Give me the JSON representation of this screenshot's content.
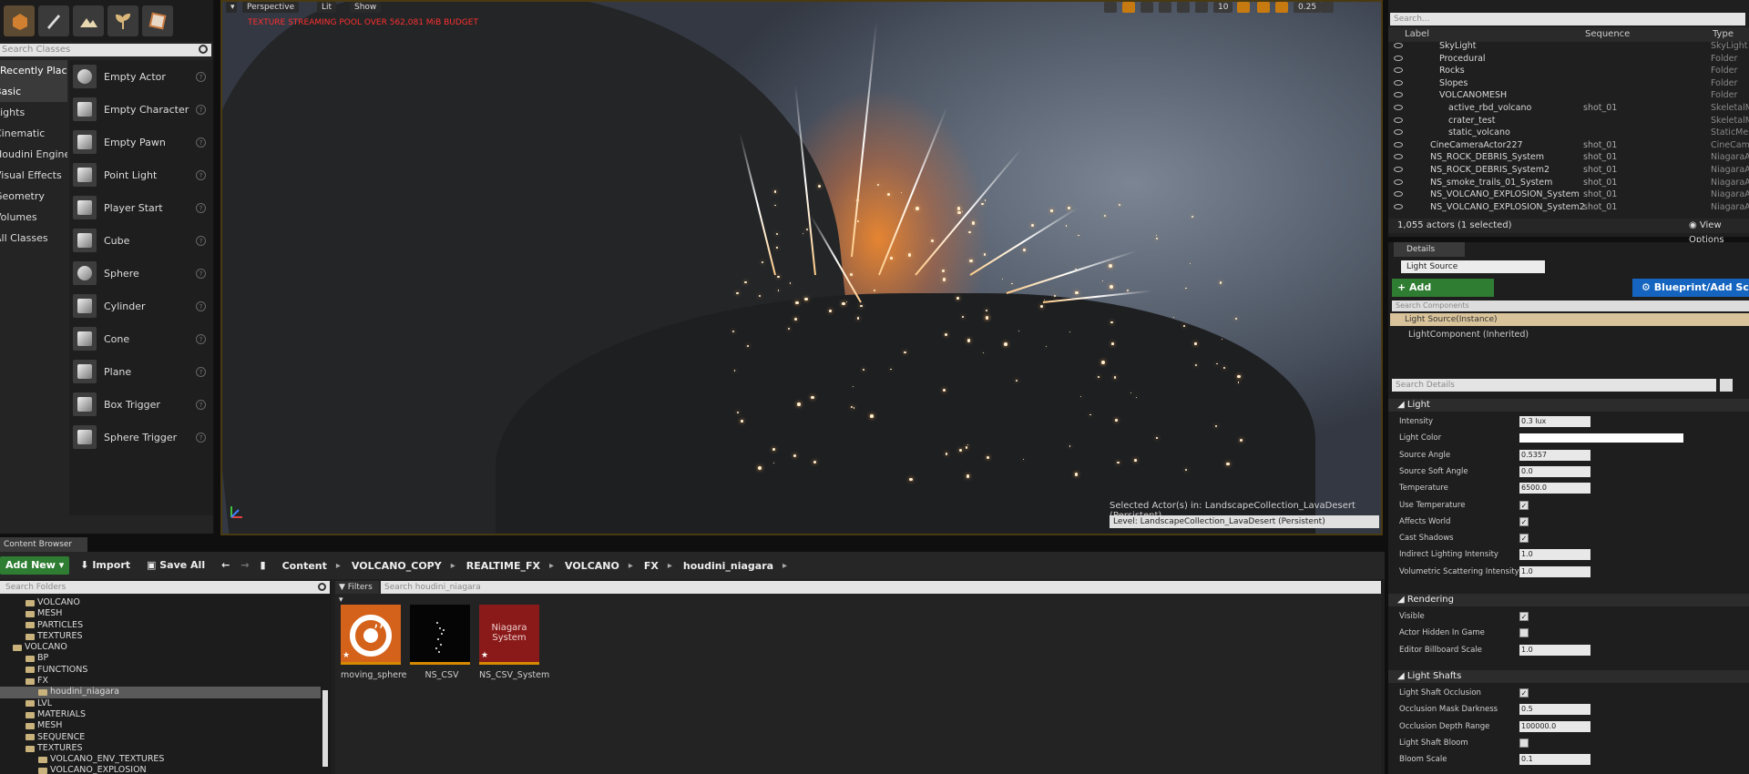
{
  "place_actors": {
    "search_placeholder": "Search Classes",
    "categories": [
      "Recently Placed",
      "Basic",
      "Lights",
      "Cinematic",
      "Houdini Engine",
      "Visual Effects",
      "Geometry",
      "Volumes",
      "All Classes"
    ],
    "actors": [
      "Empty Actor",
      "Empty Character",
      "Empty Pawn",
      "Point Light",
      "Player Start",
      "Cube",
      "Sphere",
      "Cylinder",
      "Cone",
      "Plane",
      "Box Trigger",
      "Sphere Trigger"
    ]
  },
  "viewport": {
    "perspective": "Perspective",
    "lit": "Lit",
    "show": "Show",
    "streaming_warning": "TEXTURE STREAMING POOL OVER 562,081 MiB BUDGET",
    "selected_actor": "Selected Actor(s) in:  LandscapeCollection_LavaDesert (Persistent)",
    "level": "Level:  LandscapeCollection_LavaDesert (Persistent)",
    "toolbar_values": [
      "10",
      "0.25"
    ]
  },
  "content_browser": {
    "tab": "Content Browser",
    "add_new": "Add New",
    "import": "Import",
    "save_all": "Save All",
    "breadcrumb": [
      "Content",
      "VOLCANO_COPY",
      "REALTIME_FX",
      "VOLCANO",
      "FX",
      "houdini_niagara"
    ],
    "search_folders": "Search Folders",
    "filters": "Filters",
    "search_assets": "Search houdini_niagara",
    "folders": [
      {
        "name": "VOLCANO",
        "indent": 1
      },
      {
        "name": "MESH",
        "indent": 1
      },
      {
        "name": "PARTICLES",
        "indent": 1
      },
      {
        "name": "TEXTURES",
        "indent": 1
      },
      {
        "name": "VOLCANO",
        "indent": 0
      },
      {
        "name": "BP",
        "indent": 1
      },
      {
        "name": "FUNCTIONS",
        "indent": 1
      },
      {
        "name": "FX",
        "indent": 1
      },
      {
        "name": "houdini_niagara",
        "indent": 2,
        "selected": true
      },
      {
        "name": "LVL",
        "indent": 1
      },
      {
        "name": "MATERIALS",
        "indent": 1
      },
      {
        "name": "MESH",
        "indent": 1
      },
      {
        "name": "SEQUENCE",
        "indent": 1
      },
      {
        "name": "TEXTURES",
        "indent": 1
      },
      {
        "name": "VOLCANO_ENV_TEXTURES",
        "indent": 2
      },
      {
        "name": "VOLCANO_EXPLOSION",
        "indent": 2
      }
    ],
    "assets": [
      {
        "name": "moving_sphere",
        "thumb_text": ""
      },
      {
        "name": "NS_CSV",
        "thumb_text": ""
      },
      {
        "name": "NS_CSV_System",
        "thumb_text": "Niagara System"
      }
    ]
  },
  "outliner": {
    "search_placeholder": "Search...",
    "columns": [
      "Label",
      "Sequence",
      "Type"
    ],
    "rows": [
      {
        "label": "SkyLight",
        "seq": "",
        "type": "SkyLight",
        "indent": 1
      },
      {
        "label": "Procedural",
        "seq": "",
        "type": "Folder",
        "indent": 1
      },
      {
        "label": "Rocks",
        "seq": "",
        "type": "Folder",
        "indent": 1
      },
      {
        "label": "Slopes",
        "seq": "",
        "type": "Folder",
        "indent": 1
      },
      {
        "label": "VOLCANOMESH",
        "seq": "",
        "type": "Folder",
        "indent": 1
      },
      {
        "label": "active_rbd_volcano",
        "seq": "shot_01",
        "type": "SkeletalMe",
        "indent": 2
      },
      {
        "label": "crater_test",
        "seq": "",
        "type": "SkeletalMe",
        "indent": 2
      },
      {
        "label": "static_volcano",
        "seq": "",
        "type": "StaticMesh",
        "indent": 2
      },
      {
        "label": "CineCameraActor227",
        "seq": "shot_01",
        "type": "CineCamer",
        "indent": 0
      },
      {
        "label": "NS_ROCK_DEBRIS_System",
        "seq": "shot_01",
        "type": "NiagaraAc",
        "indent": 0
      },
      {
        "label": "NS_ROCK_DEBRIS_System2",
        "seq": "shot_01",
        "type": "NiagaraAc",
        "indent": 0
      },
      {
        "label": "NS_smoke_trails_01_System",
        "seq": "shot_01",
        "type": "NiagaraAc",
        "indent": 0
      },
      {
        "label": "NS_VOLCANO_EXPLOSION_System",
        "seq": "shot_01",
        "type": "NiagaraAc",
        "indent": 0
      },
      {
        "label": "NS_VOLCANO_EXPLOSION_System2",
        "seq": "shot_01",
        "type": "NiagaraAc",
        "indent": 0
      }
    ],
    "count": "1,055 actors (1 selected)",
    "view_options": "View Options"
  },
  "details": {
    "tab": "Details",
    "name": "Light Source",
    "add_component": "+ Add Component -",
    "blueprint": "Blueprint/Add Script",
    "search_components": "Search Components",
    "instance": "Light Source(Instance)",
    "inherited": "LightComponent (Inherited)",
    "search_details": "Search Details",
    "sections": {
      "light": "Light",
      "rendering": "Rendering",
      "shafts": "Light Shafts"
    },
    "light_props": [
      {
        "name": "Intensity",
        "value": "0.3 lux",
        "kind": "num"
      },
      {
        "name": "Light Color",
        "value": "",
        "kind": "color"
      },
      {
        "name": "Source Angle",
        "value": "0.5357",
        "kind": "num"
      },
      {
        "name": "Source Soft Angle",
        "value": "0.0",
        "kind": "num"
      },
      {
        "name": "Temperature",
        "value": "6500.0",
        "kind": "num"
      },
      {
        "name": "Use Temperature",
        "value": "✓",
        "kind": "check"
      },
      {
        "name": "Affects World",
        "value": "✓",
        "kind": "check"
      },
      {
        "name": "Cast Shadows",
        "value": "✓",
        "kind": "check"
      },
      {
        "name": "Indirect Lighting Intensity",
        "value": "1.0",
        "kind": "num"
      },
      {
        "name": "Volumetric Scattering Intensity",
        "value": "1.0",
        "kind": "num"
      }
    ],
    "render_props": [
      {
        "name": "Visible",
        "value": "✓",
        "kind": "check"
      },
      {
        "name": "Actor Hidden In Game",
        "value": "",
        "kind": "check"
      },
      {
        "name": "Editor Billboard Scale",
        "value": "1.0",
        "kind": "num"
      }
    ],
    "shaft_props": [
      {
        "name": "Light Shaft Occlusion",
        "value": "✓",
        "kind": "check"
      },
      {
        "name": "Occlusion Mask Darkness",
        "value": "0.5",
        "kind": "num"
      },
      {
        "name": "Occlusion Depth Range",
        "value": "100000.0",
        "kind": "num"
      },
      {
        "name": "Light Shaft Bloom",
        "value": "",
        "kind": "check"
      },
      {
        "name": "Bloom Scale",
        "value": "0.1",
        "kind": "num"
      }
    ]
  }
}
